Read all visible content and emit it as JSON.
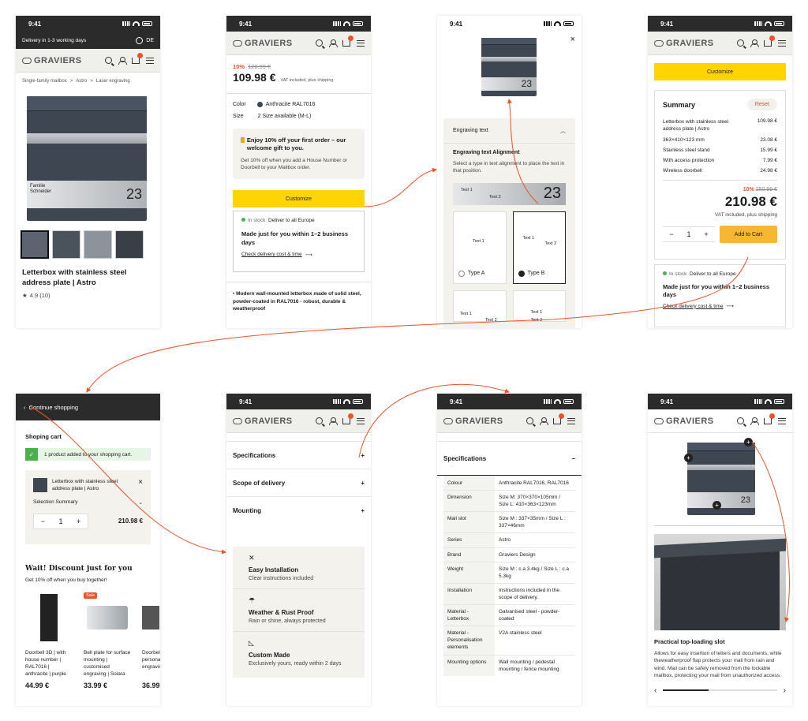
{
  "status": {
    "time": "9:41"
  },
  "brand": {
    "name": "GRAVIERS"
  },
  "colors": {
    "accent": "#ffd400",
    "orange": "#e8532a",
    "dark": "#2b2b2b"
  },
  "s1": {
    "delivery": "Delivery in 1-3 working days",
    "lang": "DE",
    "breadcrumb": [
      "Single-family mailbox",
      ">",
      "Astro",
      ">",
      "Laser engraving"
    ],
    "plate_name": [
      "Familie",
      "Schneider"
    ],
    "plate_number": "23",
    "title": "Letterbox with stainless steel address plate | Astro",
    "rating": "4.9 (10)"
  },
  "s2": {
    "discount": "10%",
    "old_price": "120.99 €",
    "price": "109.98 €",
    "vat": "VAT included, plus shipping",
    "color_label": "Color",
    "color_value": "Anthracite RAL7016",
    "size_label": "Size",
    "size_value": "2 Size available (M-L)",
    "promo_title": "Enjoy 10% off your first order – our welcome gift to you.",
    "promo_text": "Get 10% off when you add a House Number or Doorbell to your Mailbox order.",
    "customize": "Customize",
    "stock": "In stock",
    "deliver": "Deliver to all Europe",
    "made": "Made just for you within 1–2 business days",
    "check": "Check delivery cost & time",
    "bullet": "Modern wall-mounted letterbox made of solid steel, powder-coated in RAL7016 - robust, durable & weatherproof"
  },
  "s3": {
    "section": "Engraving text",
    "align_title": "Engraving text Alignment",
    "align_text": "Select a type in text alignment to place the text in that position.",
    "preview": [
      "Text 1",
      "Text 2",
      "23"
    ],
    "type_a": "Type A",
    "type_b": "Type B",
    "t1": "Text 1",
    "t2": "Text 2"
  },
  "s4": {
    "customize": "Customize",
    "summary": "Summary",
    "reset": "Reset",
    "items": [
      {
        "name": "Letterbox with stainless steel address plate | Astro",
        "price": "109.98 €"
      },
      {
        "name": "363×410×123 mm",
        "price": "23.08 €"
      },
      {
        "name": "Stainless steel stand",
        "price": "15.99 €"
      },
      {
        "name": "With access protection",
        "price": "7.99 €"
      },
      {
        "name": "Wireless doorbell",
        "price": "24.98 €"
      }
    ],
    "discount": "10%",
    "old_price": "250.99 €",
    "total": "210.98 €",
    "vat": "VAT included, plus shipping",
    "qty": "1",
    "add": "Add to Cart",
    "stock": "In stock",
    "deliver": "Deliver to all Europe",
    "made": "Made just for you within 1–2 business days",
    "check": "Check delivery cost & time"
  },
  "s5": {
    "back": "Continue shopping",
    "cart": "Shoping cart",
    "added": "1 product added to your shopping cart.",
    "item": "Letterbox with stainless steel address plate | Astro",
    "summary": "Selection Summary",
    "qty": "1",
    "price": "210.98 €",
    "wait": "Wait! Discount just for you",
    "wait_sub": "Get 10% off when you buy together!",
    "sale": "Sale",
    "products": [
      {
        "name": "Doorbell 3D | with house number | RAL7016 | anthracite | purple",
        "price": "44.99 €"
      },
      {
        "name": "Bell plate for surface mounting | customised engraving | Solara",
        "price": "33.99 €"
      },
      {
        "name": "Doorbell personalised engraving",
        "price": "36.99"
      }
    ]
  },
  "s6": {
    "sections": [
      "Specifications",
      "Scope of delivery",
      "Mounting"
    ],
    "features": [
      {
        "title": "Easy Installation",
        "sub": "Clear instructions included"
      },
      {
        "title": "Weather & Rust Proof",
        "sub": "Rain or shine, always protected"
      },
      {
        "title": "Custom Made",
        "sub": "Exclusively yours, ready within 2 days"
      }
    ]
  },
  "s7": {
    "title": "Specifications",
    "rows": [
      {
        "k": "Colour",
        "v": "Anthracite RAL7016, RAL7016"
      },
      {
        "k": "Dimension",
        "v": "Size M: 370×370×105mm / Size L: 410×363×123mm"
      },
      {
        "k": "Mail slot",
        "v": "Size M : 337×35mm / Size L : 337×46mm"
      },
      {
        "k": "Series",
        "v": "Astro"
      },
      {
        "k": "Brand",
        "v": "Graviers Design"
      },
      {
        "k": "Weight",
        "v": "Size M : c.a 3.4kg / Size L : c.a 5.3kg"
      },
      {
        "k": "Installation",
        "v": "Instructions included in the scope of delivery."
      },
      {
        "k": "Material - Letterbox",
        "v": "Galvanised steel - powder-coated"
      },
      {
        "k": "Material - Personalisation elements",
        "v": "V2A stainless steel"
      },
      {
        "k": "Mounting options",
        "v": "Wall mounting / pedestal mounting / fence mounting"
      }
    ]
  },
  "s8": {
    "plate_number": "23",
    "feature_title": "Practical top-loading slot",
    "feature_text": "Allows for easy insertion of letters and documents, while theweatherproof flap protects your mail from rain and wind. Mail can be safely removed from the lockable mailbox, protecting your mail from unauthorized access."
  }
}
